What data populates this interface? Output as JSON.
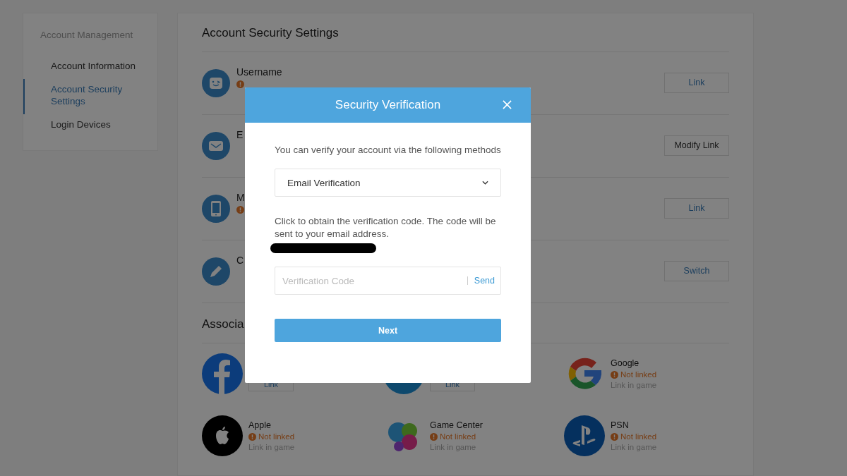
{
  "sidebar": {
    "heading": "Account Management",
    "items": [
      {
        "label": "Account Information",
        "selected": false
      },
      {
        "label": "Account Security Settings",
        "selected": true
      },
      {
        "label": "Login Devices",
        "selected": false
      }
    ]
  },
  "main": {
    "title": "Account Security Settings",
    "rows": [
      {
        "label": "Username",
        "warning": true,
        "button": "Link"
      },
      {
        "label": "E",
        "warning": false,
        "button": "Modify Link"
      },
      {
        "label": "M",
        "warning": true,
        "button": "Link"
      },
      {
        "label": "C",
        "warning": false,
        "button": "Switch"
      }
    ],
    "associated_heading": "Associa",
    "accounts": [
      {
        "kind": "button",
        "button": "Link"
      },
      {
        "kind": "button",
        "button": "Link"
      },
      {
        "kind": "status",
        "name": "Google",
        "status": "Not linked",
        "hint": "Link in game"
      },
      {
        "kind": "status",
        "name": "Apple",
        "status": "Not linked",
        "hint": "Link in game"
      },
      {
        "kind": "status",
        "name": "Game Center",
        "status": "Not linked",
        "hint": "Link in game"
      },
      {
        "kind": "status",
        "name": "PSN",
        "status": "Not linked",
        "hint": "Link in game"
      }
    ]
  },
  "dialog": {
    "title": "Security Verification",
    "intro": "You can verify your account via the following methods",
    "method": "Email Verification",
    "notice": "Click to obtain the verification code. The code will be sent to your email address.",
    "code_placeholder": "Verification Code",
    "send": "Send",
    "next": "Next"
  }
}
